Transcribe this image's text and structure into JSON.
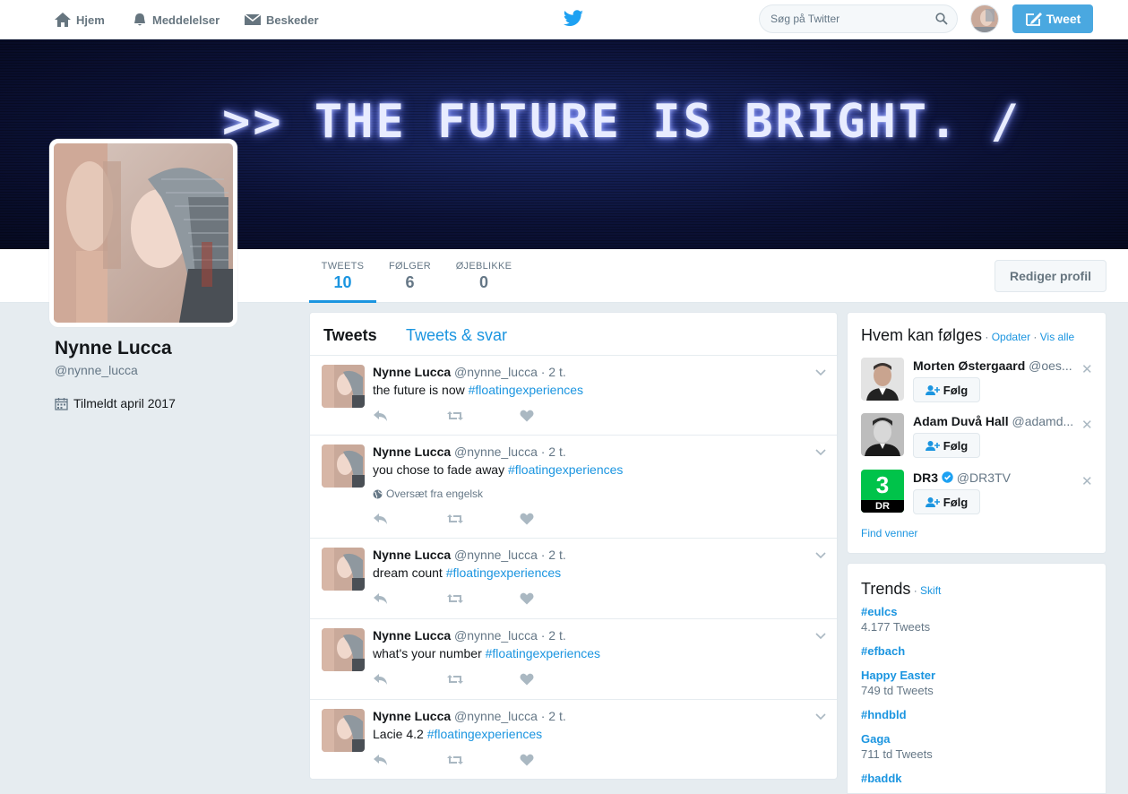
{
  "nav": {
    "home": "Hjem",
    "notifications": "Meddelelser",
    "messages": "Beskeder",
    "search_placeholder": "Søg på Twitter",
    "tweet_button": "Tweet"
  },
  "banner": {
    "text": ">> THE FUTURE IS BRIGHT. /"
  },
  "profile": {
    "name": "Nynne Lucca",
    "handle": "@nynne_lucca",
    "joined": "Tilmeldt april 2017",
    "edit_button": "Rediger profil",
    "stats": [
      {
        "label": "TWEETS",
        "value": "10"
      },
      {
        "label": "FØLGER",
        "value": "6"
      },
      {
        "label": "ØJEBLIKKE",
        "value": "0"
      }
    ]
  },
  "timeline": {
    "tabs": [
      "Tweets",
      "Tweets & svar"
    ],
    "tweets": [
      {
        "name": "Nynne Lucca",
        "handle": "@nynne_lucca",
        "time": "· 2 t.",
        "text": "the future is now ",
        "tag": "#floatingexperiences",
        "translate": ""
      },
      {
        "name": "Nynne Lucca",
        "handle": "@nynne_lucca",
        "time": "· 2 t.",
        "text": "you chose to fade away ",
        "tag": "#floatingexperiences",
        "translate": "Oversæt fra engelsk"
      },
      {
        "name": "Nynne Lucca",
        "handle": "@nynne_lucca",
        "time": "· 2 t.",
        "text": "dream count ",
        "tag": "#floatingexperiences",
        "translate": ""
      },
      {
        "name": "Nynne Lucca",
        "handle": "@nynne_lucca",
        "time": "· 2 t.",
        "text": "what's your number ",
        "tag": "#floatingexperiences",
        "translate": ""
      },
      {
        "name": "Nynne Lucca",
        "handle": "@nynne_lucca",
        "time": "· 2 t.",
        "text": "Lacie 4.2 ",
        "tag": "#floatingexperiences",
        "translate": ""
      }
    ]
  },
  "who_to_follow": {
    "title": "Hvem kan følges",
    "sep1": " · ",
    "refresh": "Opdater",
    "sep2": " · ",
    "view_all": "Vis alle",
    "follow_label": "Følg",
    "find_friends": "Find venner",
    "suggestions": [
      {
        "name": "Morten Østergaard",
        "handle": "@oes..."
      },
      {
        "name": "Adam Duvå Hall",
        "handle": "@adamd..."
      },
      {
        "name": "DR3",
        "handle": "@DR3TV",
        "logo_number": "3",
        "logo_text": "DR"
      }
    ]
  },
  "trends": {
    "title": "Trends",
    "sep": " · ",
    "change": "Skift",
    "items": [
      {
        "name": "#eulcs",
        "count": "4.177 Tweets"
      },
      {
        "name": "#efbach",
        "count": ""
      },
      {
        "name": "Happy Easter",
        "count": "749 td Tweets"
      },
      {
        "name": "#hndbld",
        "count": ""
      },
      {
        "name": "Gaga",
        "count": "711 td Tweets"
      },
      {
        "name": "#baddk",
        "count": ""
      }
    ]
  },
  "colors": {
    "accent": "#1b95e0",
    "tweet_button": "#4aa8e0",
    "background": "#e6ecf0"
  }
}
